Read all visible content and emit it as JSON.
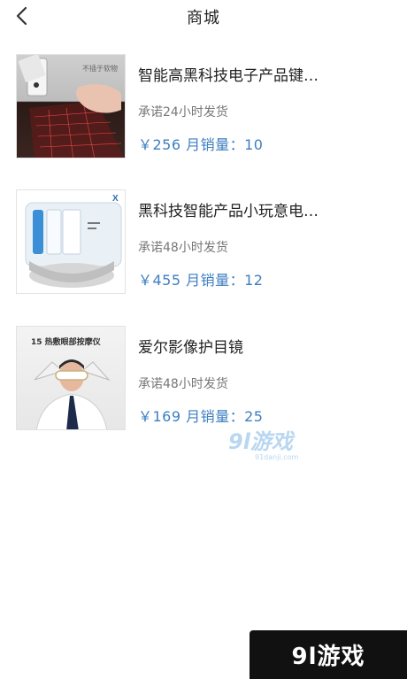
{
  "header": {
    "title": "商城"
  },
  "products": [
    {
      "name": "智能高黑科技电子产品键…",
      "shipping": "承诺24小时发货",
      "price_line": "￥256 月销量：10",
      "thumb_caption": "不插于软物"
    },
    {
      "name": "黑科技智能产品小玩意电…",
      "shipping": "承诺48小时发货",
      "price_line": "￥455 月销量：12"
    },
    {
      "name": "爱尔影像护目镜",
      "shipping": "承诺48小时发货",
      "price_line": "￥169 月销量：25",
      "thumb_caption": "15 热敷眼部按摩仪"
    }
  ],
  "watermarks": {
    "mid": "9l游戏",
    "mid_sub": "91danji.com",
    "badge": "9l游戏"
  },
  "colors": {
    "price": "#3d7ec0",
    "text": "#222222",
    "muted": "#777777"
  }
}
